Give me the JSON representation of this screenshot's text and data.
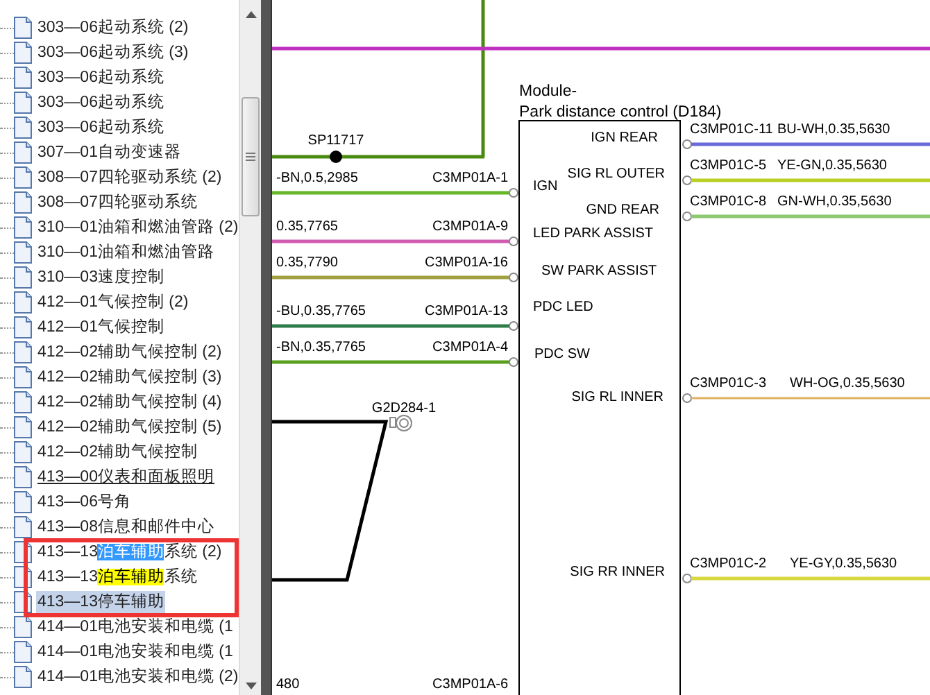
{
  "tree": {
    "items": [
      {
        "text": "303—06起动系统 (2)",
        "selected": false,
        "hovered": false
      },
      {
        "text": "303—06起动系统 (3)",
        "selected": false,
        "hovered": false
      },
      {
        "text": "303—06起动系统",
        "selected": false,
        "hovered": false
      },
      {
        "text": "303—06起动系统",
        "selected": false,
        "hovered": false
      },
      {
        "text": "303—06起动系统",
        "selected": false,
        "hovered": false
      },
      {
        "text": "307—01自动变速器",
        "selected": false,
        "hovered": false
      },
      {
        "text": "308—07四轮驱动系统 (2)",
        "selected": false,
        "hovered": false
      },
      {
        "text": "308—07四轮驱动系统",
        "selected": false,
        "hovered": false
      },
      {
        "text": "310—01油箱和燃油管路 (2)",
        "selected": false,
        "hovered": false
      },
      {
        "text": "310—01油箱和燃油管路",
        "selected": false,
        "hovered": false
      },
      {
        "text": "310—03速度控制",
        "selected": false,
        "hovered": false
      },
      {
        "text": "412—01气候控制 (2)",
        "selected": false,
        "hovered": false
      },
      {
        "text": "412—01气候控制",
        "selected": false,
        "hovered": false
      },
      {
        "text": "412—02辅助气候控制 (2)",
        "selected": false,
        "hovered": false
      },
      {
        "text": "412—02辅助气候控制 (3)",
        "selected": false,
        "hovered": false
      },
      {
        "text": "412—02辅助气候控制 (4)",
        "selected": false,
        "hovered": false
      },
      {
        "text": "412—02辅助气候控制 (5)",
        "selected": false,
        "hovered": false
      },
      {
        "text": "412—02辅助气候控制",
        "selected": false,
        "hovered": false
      },
      {
        "text": "413—00仪表和面板照明",
        "selected": false,
        "hovered": true
      },
      {
        "text": "413—06号角",
        "selected": false,
        "hovered": false
      },
      {
        "text": "413—08信息和邮件中心",
        "selected": false,
        "hovered": false
      },
      {
        "text": "413—13",
        "highlight": "泊车辅助",
        "kind": "selection",
        "suffix": "系统 (2)",
        "selected": false,
        "hovered": false
      },
      {
        "text": "413—13",
        "highlight": "泊车辅助",
        "kind": "search",
        "suffix": "系统",
        "selected": false,
        "hovered": false
      },
      {
        "text": "413—13停车辅助",
        "selected": true,
        "hovered": false
      },
      {
        "text": "414—01电池安装和电缆 (1",
        "selected": false,
        "hovered": false
      },
      {
        "text": "414—01电池安装和电缆 (1",
        "selected": false,
        "hovered": false
      },
      {
        "text": "414—01电池安装和电缆 (2)",
        "selected": false,
        "hovered": false
      }
    ]
  },
  "diagram": {
    "splice": {
      "label": "SP11717"
    },
    "ground": {
      "label": "G2D284-1"
    },
    "module": {
      "title": [
        "Module-",
        "Park distance control (D184)"
      ],
      "pins": [
        "IGN REAR",
        "SIG RL OUTER",
        "IGN",
        "GND REAR",
        "LED PARK ASSIST",
        "SW PARK ASSIST",
        "PDC LED",
        "PDC SW",
        "SIG RL INNER",
        "SIG RR INNER"
      ]
    },
    "left_wires": [
      {
        "spec": "-BN,0.5,2985",
        "connector": "C3MP01A-1",
        "color": "#66b82a"
      },
      {
        "spec": "0.35,7765",
        "connector": "C3MP01A-9",
        "color": "#d05cb0"
      },
      {
        "spec": "0.35,7790",
        "connector": "C3MP01A-16",
        "color": "#a0a040"
      },
      {
        "spec": "-BU,0.35,7765",
        "connector": "C3MP01A-13",
        "color": "#2e7d4a"
      },
      {
        "spec": "-BN,0.35,7765",
        "connector": "C3MP01A-4",
        "color": "#5aa020"
      }
    ],
    "right_wires": [
      {
        "connector": "C3MP01C-11",
        "spec": "BU-WH,0.35,5630",
        "color": "#6a6ad8"
      },
      {
        "connector": "C3MP01C-5",
        "spec": "YE-GN,0.35,5630",
        "color": "#b8d020"
      },
      {
        "connector": "C3MP01C-8",
        "spec": "GN-WH,0.35,5630",
        "color": "#8cc870"
      },
      {
        "connector": "C3MP01C-3",
        "spec": "WH-OG,0.35,5630",
        "color": "#e0b060"
      },
      {
        "connector": "C3MP01C-2",
        "spec": "YE-GY,0.35,5630",
        "color": "#d8d840"
      }
    ],
    "bottom_labels": [
      "480",
      "C3MP01A-6"
    ]
  }
}
